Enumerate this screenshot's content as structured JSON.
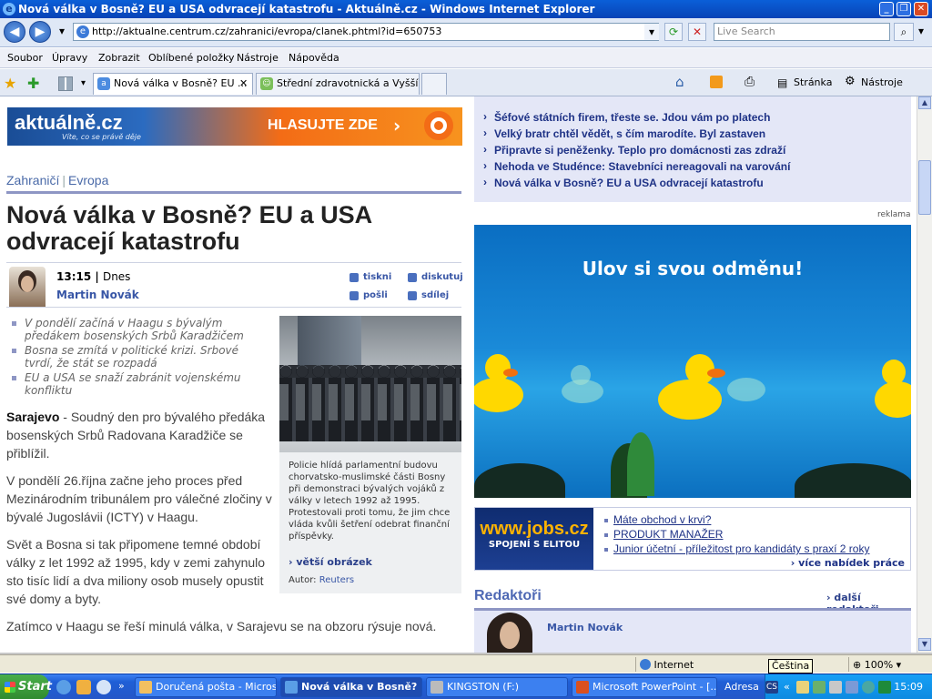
{
  "window": {
    "title": "Nová válka v Bosně? EU a USA odvracejí katastrofu - Aktuálně.cz - Windows Internet Explorer",
    "min": "_",
    "max": "❐",
    "close": "✕"
  },
  "addressbar": {
    "url": "http://aktualne.centrum.cz/zahranici/evropa/clanek.phtml?id=650753",
    "search_placeholder": "Live Search",
    "back": "◀",
    "forward": "▶"
  },
  "menu": [
    "Soubor",
    "Úpravy",
    "Zobrazit",
    "Oblíbené položky",
    "Nástroje",
    "Nápověda"
  ],
  "tabs": [
    {
      "label": "Nová válka v Bosně? EU ...",
      "active": true
    },
    {
      "label": "Střední zdravotnická a Vyšší ...",
      "active": false
    }
  ],
  "toolbar_right": {
    "page": "Stránka",
    "tools": "Nástroje"
  },
  "banner": {
    "logo": "aktuálně.cz",
    "tagline": "Víte, co se právě děje",
    "cta": "HLASUJTE ZDE",
    "arrow": "›"
  },
  "breadcrumb": [
    "Zahraničí",
    "Evropa"
  ],
  "headline": "Nová válka v Bosně? EU a USA odvracejí katastrofu",
  "meta": {
    "time": "13:15",
    "day": "Dnes",
    "author": "Martin Novák",
    "actions": [
      "tiskni",
      "diskutuj",
      "pošli",
      "sdílej"
    ]
  },
  "bullets": [
    "V pondělí začíná v Haagu s bývalým předákem bosenských Srbů Karadžičem",
    "Bosna se zmítá v politické krizi. Srbové tvrdí, že stát se rozpadá",
    "EU a USA se snaží zabránit vojenskému konfliktu"
  ],
  "article": {
    "p1_lead": "Sarajevo",
    "p1_rest": " - Soudný den pro bývalého předáka bosenských Srbů Radovana Karadžiče se přiblížil.",
    "p2": "V pondělí 26.října začne jeho proces před Mezinárodním tribunálem pro válečné zločiny v bývalé Jugoslávii (ICTY) v Haagu.",
    "p3": "Svět a Bosna si tak připomene temné období války z let 1992 až 1995, kdy v zemi zahynulo sto tisíc lidí a dva miliony osob musely opustit své domy a byty.",
    "p4": "Zatímco v Haagu se řeší minulá válka, v Sarajevu se na obzoru rýsuje nová."
  },
  "photo": {
    "caption": "Policie hlídá parlamentní budovu chorvatsko-muslimské části Bosny při demonstraci bývalých vojáků z války v letech 1992 až 1995. Protestovali proti tomu, že jim chce vláda kvůli šetření odebrat finanční příspěvky.",
    "more": "› větší obrázek",
    "author_label": "Autor:",
    "author": "Reuters"
  },
  "related_links": [
    "Šéfové státních firem, třeste se. Jdou vám po platech",
    "Velký bratr chtěl vědět, s čím marodíte. Byl zastaven",
    "Připravte si peněženky. Teplo pro domácnosti zas zdraží",
    "Nehoda ve Studénce: Stavebníci nereagovali na varování",
    "Nová válka v Bosně? EU a USA odvracejí katastrofu"
  ],
  "reklama": "reklama",
  "ad": {
    "title": "Ulov si svou odměnu!"
  },
  "jobs": {
    "logo": "www.jobs.cz",
    "slogan": "SPOJENÍ S ELITOU",
    "links": [
      "Máte obchod v krvi?",
      "PRODUKT MANAŽER",
      "Junior účetní - příležitost pro kandidáty s praxí 2 roky"
    ],
    "more": "› více nabídek práce"
  },
  "editors": {
    "title": "Redaktoři",
    "more": "› další redaktoři",
    "name": "Martin Novák"
  },
  "statusbar": {
    "zone": "Internet",
    "zoom": "100%",
    "tooltip": "Čeština"
  },
  "taskbar": {
    "start": "Start",
    "buttons": [
      {
        "label": "Doručená pošta - Micros...",
        "active": false
      },
      {
        "label": "Nová válka v Bosně? ...",
        "active": true
      },
      {
        "label": "KINGSTON (F:)",
        "active": false
      },
      {
        "label": "Microsoft PowerPoint - [...",
        "active": false
      }
    ],
    "address_label": "Adresa",
    "clock": "15:09"
  },
  "colors": {
    "titlebar": "#0a5fd8",
    "accent_link": "#1e3286",
    "orange": "#f36c16",
    "breadcrumb_line": "#8e96c4"
  }
}
